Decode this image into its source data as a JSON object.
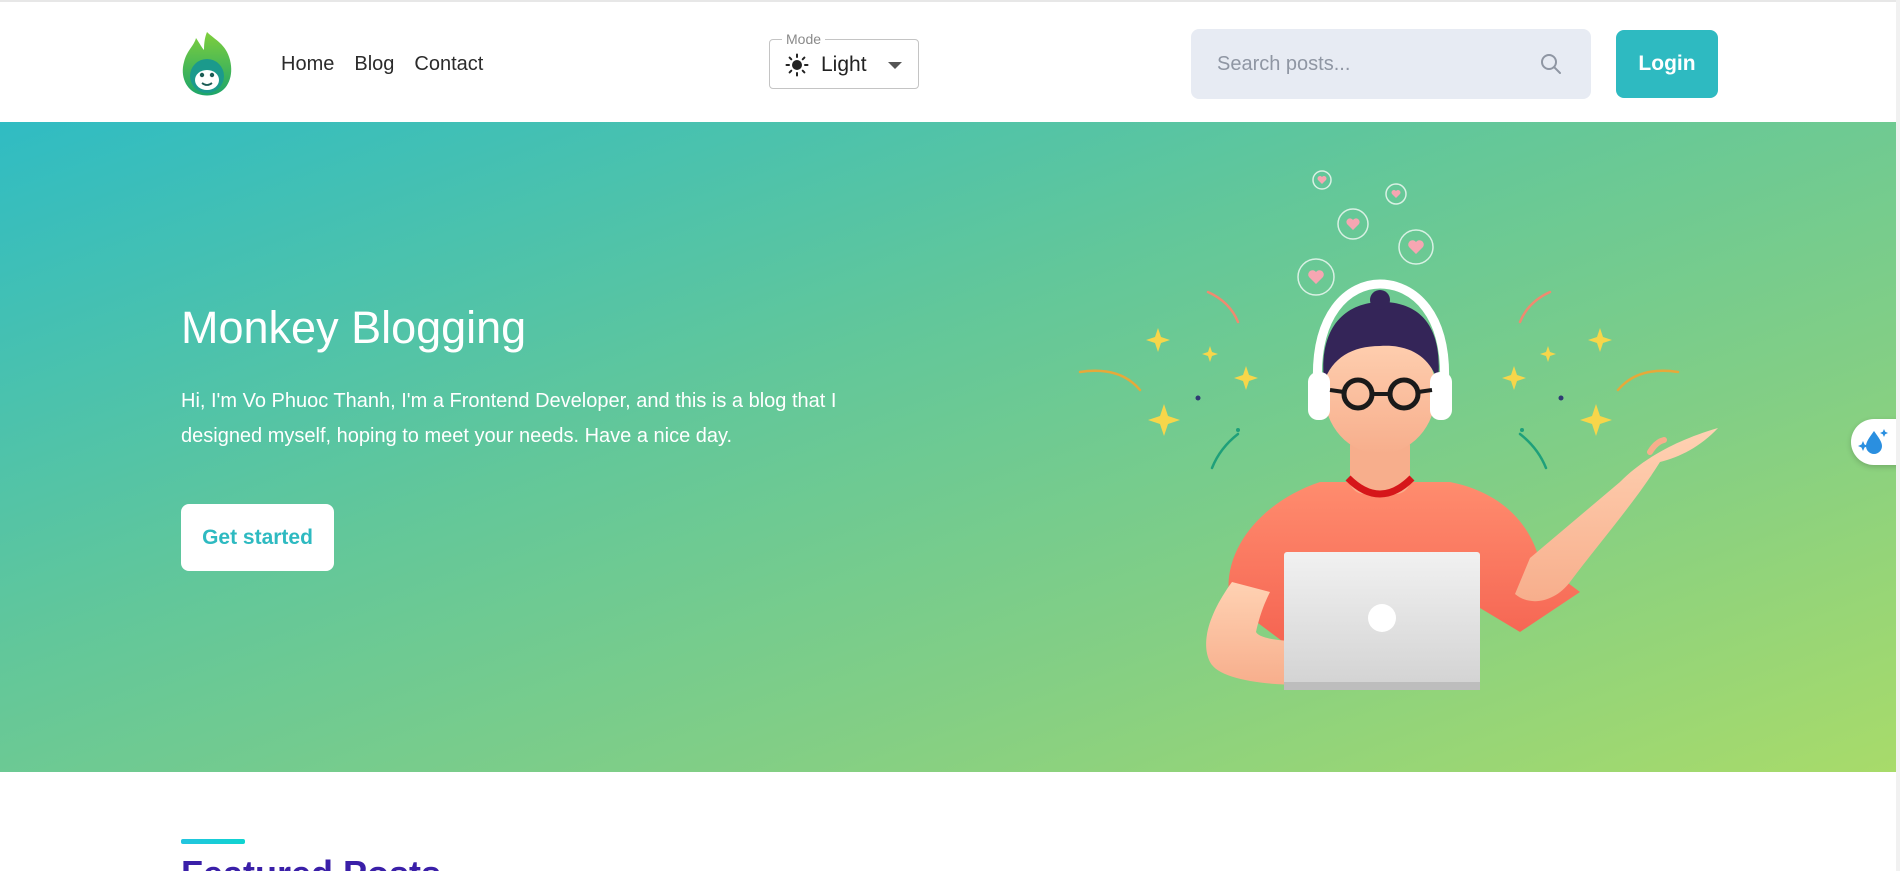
{
  "header": {
    "logo_icon": "monkey-leaf-logo-icon",
    "nav": [
      {
        "label": "Home"
      },
      {
        "label": "Blog"
      },
      {
        "label": "Contact"
      }
    ],
    "mode": {
      "legend": "Mode",
      "value": "Light",
      "icon": "sun-icon"
    },
    "search": {
      "placeholder": "Search posts...",
      "value": "",
      "icon": "search-icon"
    },
    "login_label": "Login"
  },
  "hero": {
    "title": "Monkey Blogging",
    "description": "Hi, I'm Vo Phuoc Thanh, I'm a Frontend Developer, and this is a blog that I designed myself, hoping to meet your needs. Have a nice day.",
    "cta_label": "Get started",
    "illustration": "developer-with-headphones-laptop-illustration"
  },
  "featured": {
    "title": "Featured Posts"
  },
  "side_tab": {
    "icon": "water-drop-sparkle-icon"
  },
  "colors": {
    "accent": "#2ebac1",
    "gradient_start": "#30bcc3",
    "gradient_end": "#a8db6a",
    "featured_title": "#3a1fa8"
  }
}
